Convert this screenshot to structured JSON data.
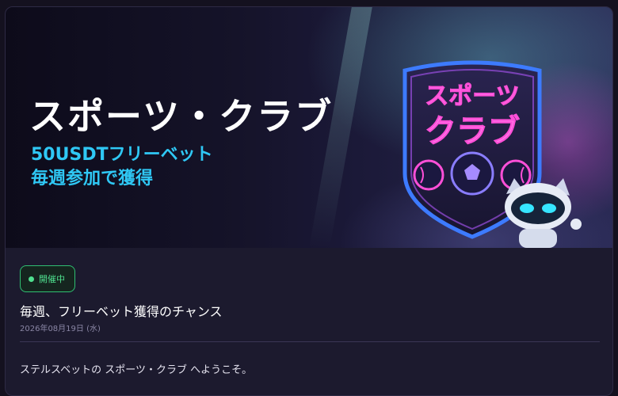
{
  "banner": {
    "title": "スポーツ・クラブ",
    "subtitle_line1": "50USDTフリーベット",
    "subtitle_line2": "毎週参加で獲得",
    "shield_line1": "スポーツ",
    "shield_line2": "クラブ"
  },
  "status": {
    "label": "開催中",
    "color": "#4fe08f"
  },
  "post": {
    "title": "毎週、フリーベット獲得のチャンス",
    "date": "2026年08月19日 (水)",
    "body": "ステルスベットの スポーツ・クラブ へようこそ。"
  },
  "colors": {
    "accent": "#2fc8f5",
    "background": "#1c1a2e",
    "neon_pink": "#ff4fd8",
    "neon_blue": "#3d7bff"
  },
  "icons": {
    "status": "status-dot-icon",
    "mascot": "robot-cat-icon",
    "emblem": "shield-emblem-icon"
  }
}
